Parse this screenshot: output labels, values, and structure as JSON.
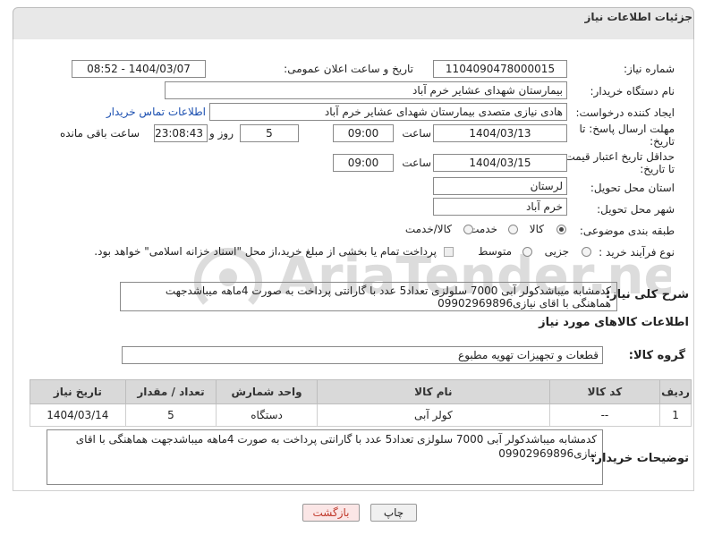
{
  "header": {
    "title": "جزئیات اطلاعات نیاز"
  },
  "form": {
    "need_number": {
      "label": "شماره نیاز:",
      "value": "1104090478000015"
    },
    "announce_datetime": {
      "label": "تاریخ و ساعت اعلان عمومی:",
      "value": "1404/03/07 - 08:52"
    },
    "buyer_org": {
      "label": "نام دستگاه خریدار:",
      "value": "بیمارستان شهدای عشایر خرم آباد"
    },
    "requester": {
      "label": "ایجاد کننده درخواست:",
      "value": "هادی نیازی متصدی بیمارستان شهدای عشایر خرم آباد",
      "link": "اطلاعات تماس خریدار"
    },
    "response_deadline": {
      "label_line1": "مهلت ارسال پاسخ: تا",
      "label_line2": "تاریخ:",
      "date": "1404/03/13",
      "time_label": "ساعت",
      "time": "09:00",
      "days": "5",
      "days_label": "روز و",
      "remaining": "23:08:43",
      "remaining_label": "ساعت باقی مانده"
    },
    "price_validity": {
      "label_line1": "حداقل تاریخ اعتبار قیمت:",
      "label_line2": "تا تاریخ:",
      "date": "1404/03/15",
      "time_label": "ساعت",
      "time": "09:00"
    },
    "delivery_province": {
      "label": "استان محل تحویل:",
      "value": "لرستان"
    },
    "delivery_city": {
      "label": "شهر محل تحویل:",
      "value": "خرم آباد"
    },
    "category": {
      "label": "طبقه بندی موضوعی:",
      "options": [
        "کالا",
        "خدمت",
        "کالا/خدمت"
      ],
      "selected": "کالا"
    },
    "purchase_process": {
      "label": "نوع فرآیند خرید :",
      "options": [
        "جزیی",
        "متوسط"
      ],
      "selected": "",
      "payment_note": "پرداخت تمام یا بخشی از مبلغ خرید،از محل \"اسناد خزانه اسلامی\" خواهد بود."
    }
  },
  "description": {
    "label": "شرح کلی نیاز:",
    "text": "کدمشابه میباشدکولر آبی 7000 سلولزی تعداد5 عدد  با گارانتی پرداخت به صورت 4ماهه میباشدجهت هماهنگی با اقای نیازی09902969896"
  },
  "goods_section": {
    "title": "اطلاعات کالاهای مورد نیاز",
    "group_label": "گروه کالا:",
    "group_value": "قطعات و تجهیزات تهویه مطبوع",
    "table": {
      "headers": [
        "ردیف",
        "کد کالا",
        "نام کالا",
        "واحد شمارش",
        "تعداد / مقدار",
        "تاریخ نیاز"
      ],
      "rows": [
        [
          "1",
          "--",
          "کولر آبی",
          "دستگاه",
          "5",
          "1404/03/14"
        ]
      ]
    }
  },
  "buyer_notes": {
    "label": "توضیحات خریدار:",
    "text": "کدمشابه میباشدکولر آبی 7000 سلولزی تعداد5 عدد  با گارانتی پرداخت به صورت 4ماهه میباشدجهت هماهنگی با اقای نیازی09902969896"
  },
  "buttons": {
    "print": "چاپ",
    "back": "بازگشت"
  },
  "watermark": {
    "text": "AriaTender.neT"
  },
  "colors": {
    "header_bg": "#e8e8e8",
    "table_header_bg": "#d9d9d9",
    "link": "#1b4fb0",
    "back_button_text": "#c0392b",
    "watermark": "#d9d9d9"
  }
}
